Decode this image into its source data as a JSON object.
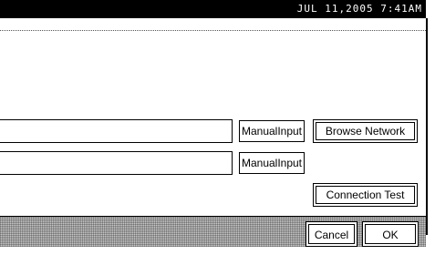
{
  "status_bar": {
    "datetime": "JUL  11,2005  7:41AM"
  },
  "form": {
    "row1": {
      "field_value": "",
      "manual_input_label": "ManualInput",
      "browse_network_label": "Browse Network"
    },
    "row2": {
      "field_value": "",
      "manual_input_label": "ManualInput"
    },
    "connection_test_label": "Connection Test"
  },
  "footer": {
    "cancel_label": "Cancel",
    "ok_label": "OK"
  }
}
